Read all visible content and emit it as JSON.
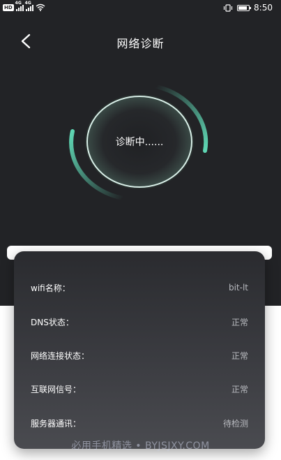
{
  "status_bar": {
    "hd_badge": "HD",
    "network_1": "4G",
    "network_2": "4G",
    "time": "8:50",
    "battery_level": 0.85
  },
  "header": {
    "title": "网络诊断",
    "back_icon": "chevron-left-icon"
  },
  "diagnosis": {
    "status_text": "诊断中......",
    "accent_color": "#5fd7b4"
  },
  "info_card": {
    "rows": [
      {
        "label": "wifi名称：",
        "value": "bit-lt"
      },
      {
        "label": "DNS状态：",
        "value": "正常"
      },
      {
        "label": "网络连接状态：",
        "value": "正常"
      },
      {
        "label": "互联网信号：",
        "value": "正常"
      },
      {
        "label": "服务器通讯：",
        "value": "待检测"
      }
    ]
  },
  "watermark": "必用手机精选 • BYJSJXY.COM"
}
